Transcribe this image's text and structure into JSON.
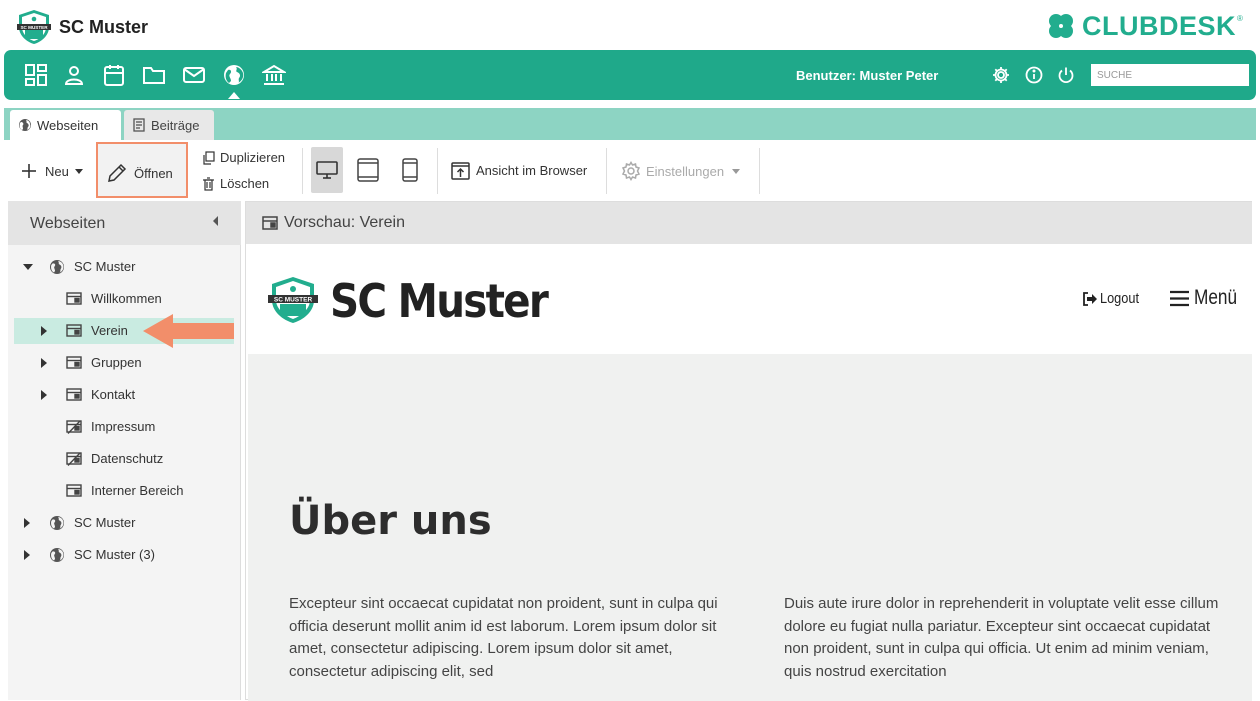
{
  "app": {
    "club_name": "SC Muster",
    "brand": "CLUBDESK",
    "brand_mark": "®",
    "accent_color": "#1fa98a",
    "highlight_color": "#f28e6a"
  },
  "nav": {
    "icons": [
      "dashboard-icon",
      "person-icon",
      "calendar-icon",
      "folder-icon",
      "mail-icon",
      "globe-icon",
      "bank-icon"
    ],
    "active": "globe-icon",
    "user_label": "Benutzer: Muster Peter",
    "search_placeholder": "SUCHE"
  },
  "tabs": [
    {
      "label": "Webseiten",
      "icon": "globe-icon",
      "active": true
    },
    {
      "label": "Beiträge",
      "icon": "document-icon",
      "active": false
    }
  ],
  "toolbar": {
    "new_label": "Neu",
    "open_label": "Öffnen",
    "duplicate_label": "Duplizieren",
    "delete_label": "Löschen",
    "view_browser_label": "Ansicht im Browser",
    "settings_label": "Einstellungen"
  },
  "left_panel": {
    "title": "Webseiten",
    "tree": [
      {
        "label": "SC Muster",
        "icon": "globe-icon",
        "caret": "down",
        "level": 0
      },
      {
        "label": "Willkommen",
        "icon": "page-icon",
        "caret": "none",
        "level": 1
      },
      {
        "label": "Verein",
        "icon": "page-icon",
        "caret": "right",
        "level": 1,
        "selected": true
      },
      {
        "label": "Gruppen",
        "icon": "page-icon",
        "caret": "right",
        "level": 1
      },
      {
        "label": "Kontakt",
        "icon": "page-icon",
        "caret": "right",
        "level": 1
      },
      {
        "label": "Impressum",
        "icon": "hidden-page-icon",
        "caret": "none",
        "level": 1
      },
      {
        "label": "Datenschutz",
        "icon": "hidden-page-icon",
        "caret": "none",
        "level": 1
      },
      {
        "label": "Interner Bereich",
        "icon": "page-icon",
        "caret": "none",
        "level": 1
      },
      {
        "label": "SC Muster",
        "icon": "globe-icon",
        "caret": "right",
        "level": 0
      },
      {
        "label": "SC Muster (3)",
        "icon": "globe-icon",
        "caret": "right",
        "level": 0
      }
    ]
  },
  "preview": {
    "title": "Vorschau: Verein",
    "site": {
      "name": "SC Muster",
      "logo_text": "SC MUSTER",
      "logout_label": "Logout",
      "menu_label": "Menü",
      "heading": "Über uns",
      "col_left": "Excepteur sint occaecat cupidatat non proident, sunt in culpa qui officia deserunt mollit anim id est laborum. Lorem ipsum dolor sit amet, consectetur adipiscing. Lorem ipsum dolor sit amet, consectetur adipiscing elit, sed",
      "col_right": "Duis aute irure dolor in reprehenderit in voluptate velit esse cillum dolore eu fugiat nulla pariatur. Excepteur sint occaecat cupidatat non proident, sunt in culpa qui officia. Ut enim ad minim veniam, quis nostrud exercitation"
    }
  }
}
